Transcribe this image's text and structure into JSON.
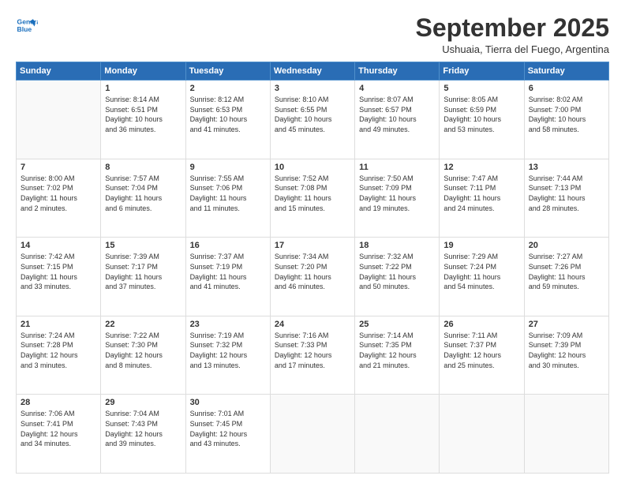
{
  "header": {
    "logo_line1": "General",
    "logo_line2": "Blue",
    "title": "September 2025",
    "location": "Ushuaia, Tierra del Fuego, Argentina"
  },
  "days_of_week": [
    "Sunday",
    "Monday",
    "Tuesday",
    "Wednesday",
    "Thursday",
    "Friday",
    "Saturday"
  ],
  "weeks": [
    [
      {
        "num": "",
        "info": ""
      },
      {
        "num": "1",
        "info": "Sunrise: 8:14 AM\nSunset: 6:51 PM\nDaylight: 10 hours\nand 36 minutes."
      },
      {
        "num": "2",
        "info": "Sunrise: 8:12 AM\nSunset: 6:53 PM\nDaylight: 10 hours\nand 41 minutes."
      },
      {
        "num": "3",
        "info": "Sunrise: 8:10 AM\nSunset: 6:55 PM\nDaylight: 10 hours\nand 45 minutes."
      },
      {
        "num": "4",
        "info": "Sunrise: 8:07 AM\nSunset: 6:57 PM\nDaylight: 10 hours\nand 49 minutes."
      },
      {
        "num": "5",
        "info": "Sunrise: 8:05 AM\nSunset: 6:59 PM\nDaylight: 10 hours\nand 53 minutes."
      },
      {
        "num": "6",
        "info": "Sunrise: 8:02 AM\nSunset: 7:00 PM\nDaylight: 10 hours\nand 58 minutes."
      }
    ],
    [
      {
        "num": "7",
        "info": "Sunrise: 8:00 AM\nSunset: 7:02 PM\nDaylight: 11 hours\nand 2 minutes."
      },
      {
        "num": "8",
        "info": "Sunrise: 7:57 AM\nSunset: 7:04 PM\nDaylight: 11 hours\nand 6 minutes."
      },
      {
        "num": "9",
        "info": "Sunrise: 7:55 AM\nSunset: 7:06 PM\nDaylight: 11 hours\nand 11 minutes."
      },
      {
        "num": "10",
        "info": "Sunrise: 7:52 AM\nSunset: 7:08 PM\nDaylight: 11 hours\nand 15 minutes."
      },
      {
        "num": "11",
        "info": "Sunrise: 7:50 AM\nSunset: 7:09 PM\nDaylight: 11 hours\nand 19 minutes."
      },
      {
        "num": "12",
        "info": "Sunrise: 7:47 AM\nSunset: 7:11 PM\nDaylight: 11 hours\nand 24 minutes."
      },
      {
        "num": "13",
        "info": "Sunrise: 7:44 AM\nSunset: 7:13 PM\nDaylight: 11 hours\nand 28 minutes."
      }
    ],
    [
      {
        "num": "14",
        "info": "Sunrise: 7:42 AM\nSunset: 7:15 PM\nDaylight: 11 hours\nand 33 minutes."
      },
      {
        "num": "15",
        "info": "Sunrise: 7:39 AM\nSunset: 7:17 PM\nDaylight: 11 hours\nand 37 minutes."
      },
      {
        "num": "16",
        "info": "Sunrise: 7:37 AM\nSunset: 7:19 PM\nDaylight: 11 hours\nand 41 minutes."
      },
      {
        "num": "17",
        "info": "Sunrise: 7:34 AM\nSunset: 7:20 PM\nDaylight: 11 hours\nand 46 minutes."
      },
      {
        "num": "18",
        "info": "Sunrise: 7:32 AM\nSunset: 7:22 PM\nDaylight: 11 hours\nand 50 minutes."
      },
      {
        "num": "19",
        "info": "Sunrise: 7:29 AM\nSunset: 7:24 PM\nDaylight: 11 hours\nand 54 minutes."
      },
      {
        "num": "20",
        "info": "Sunrise: 7:27 AM\nSunset: 7:26 PM\nDaylight: 11 hours\nand 59 minutes."
      }
    ],
    [
      {
        "num": "21",
        "info": "Sunrise: 7:24 AM\nSunset: 7:28 PM\nDaylight: 12 hours\nand 3 minutes."
      },
      {
        "num": "22",
        "info": "Sunrise: 7:22 AM\nSunset: 7:30 PM\nDaylight: 12 hours\nand 8 minutes."
      },
      {
        "num": "23",
        "info": "Sunrise: 7:19 AM\nSunset: 7:32 PM\nDaylight: 12 hours\nand 13 minutes."
      },
      {
        "num": "24",
        "info": "Sunrise: 7:16 AM\nSunset: 7:33 PM\nDaylight: 12 hours\nand 17 minutes."
      },
      {
        "num": "25",
        "info": "Sunrise: 7:14 AM\nSunset: 7:35 PM\nDaylight: 12 hours\nand 21 minutes."
      },
      {
        "num": "26",
        "info": "Sunrise: 7:11 AM\nSunset: 7:37 PM\nDaylight: 12 hours\nand 25 minutes."
      },
      {
        "num": "27",
        "info": "Sunrise: 7:09 AM\nSunset: 7:39 PM\nDaylight: 12 hours\nand 30 minutes."
      }
    ],
    [
      {
        "num": "28",
        "info": "Sunrise: 7:06 AM\nSunset: 7:41 PM\nDaylight: 12 hours\nand 34 minutes."
      },
      {
        "num": "29",
        "info": "Sunrise: 7:04 AM\nSunset: 7:43 PM\nDaylight: 12 hours\nand 39 minutes."
      },
      {
        "num": "30",
        "info": "Sunrise: 7:01 AM\nSunset: 7:45 PM\nDaylight: 12 hours\nand 43 minutes."
      },
      {
        "num": "",
        "info": ""
      },
      {
        "num": "",
        "info": ""
      },
      {
        "num": "",
        "info": ""
      },
      {
        "num": "",
        "info": ""
      }
    ]
  ]
}
